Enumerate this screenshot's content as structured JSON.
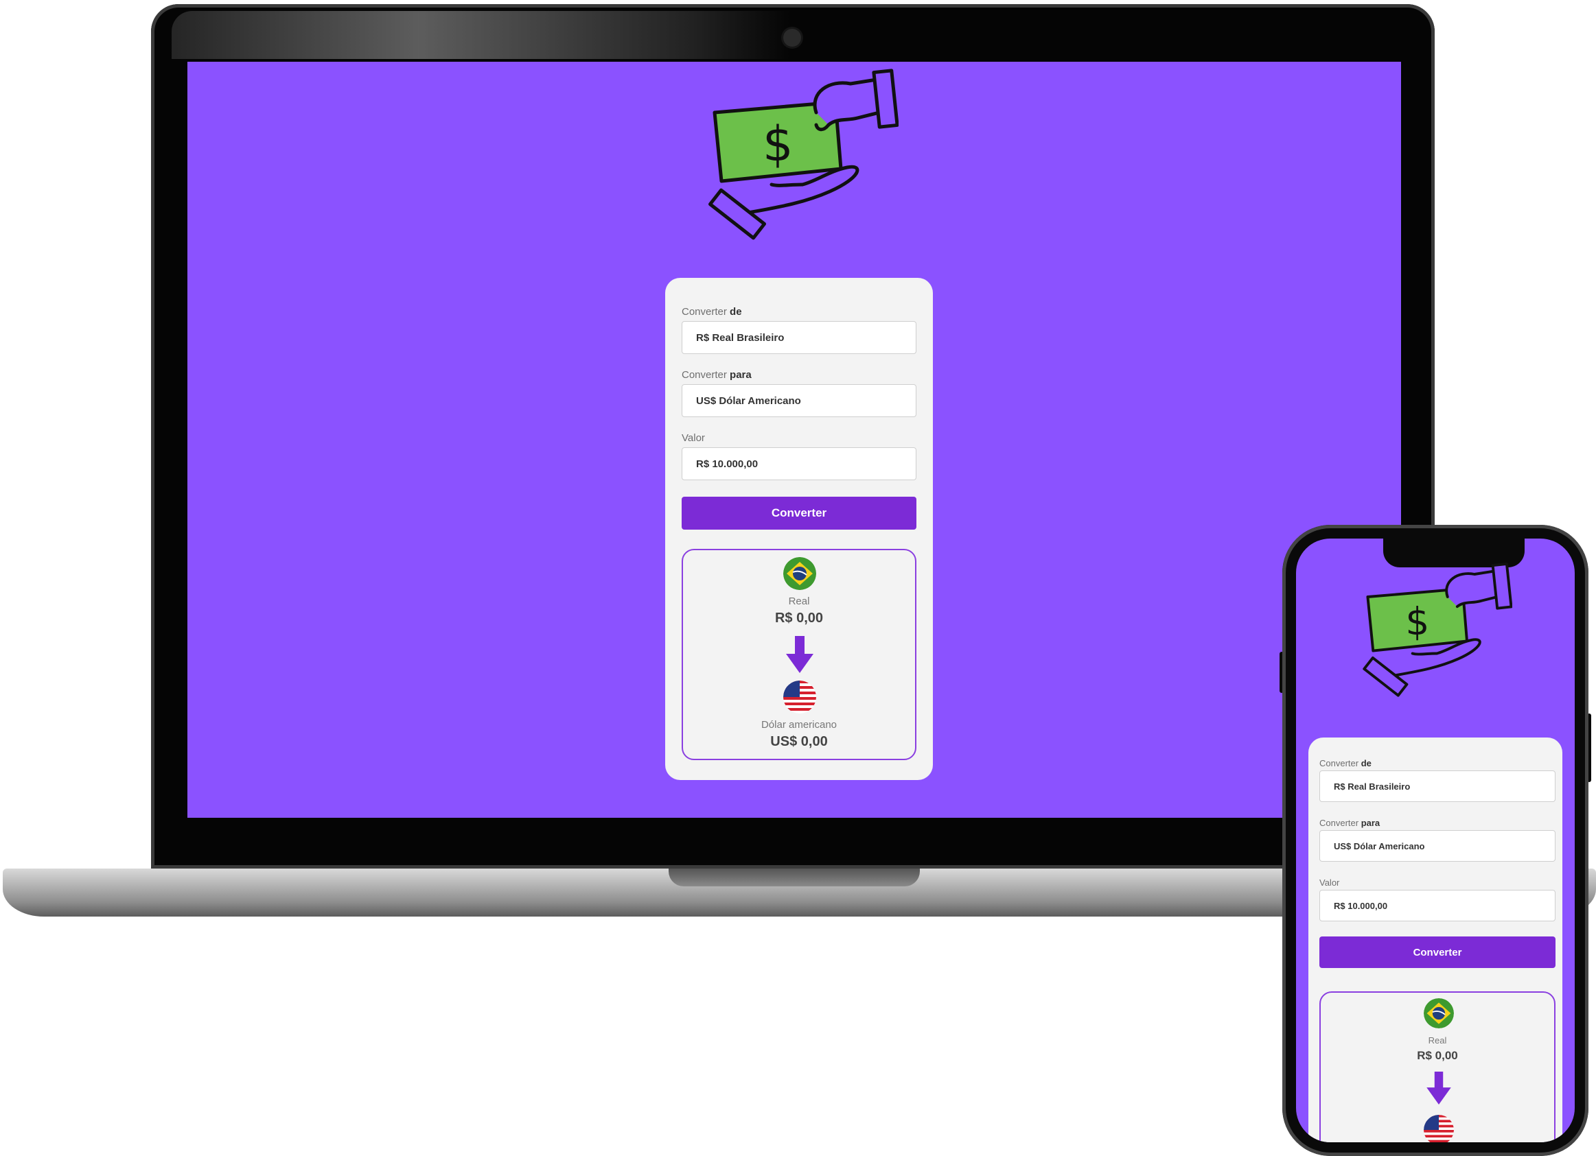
{
  "colors": {
    "screen_bg": "#8b52ff",
    "accent": "#7c2bd6",
    "card_bg": "#f3f3f3",
    "money_green": "#6cc04a"
  },
  "icons": {
    "hero": "money-exchange-hands-icon",
    "arrow": "arrow-down-icon",
    "from_flag": "brazil-flag-icon",
    "to_flag": "usa-flag-icon"
  },
  "converter": {
    "from_label_prefix": "Converter",
    "from_label_bold": "de",
    "from_value": "R$ Real Brasileiro",
    "to_label_prefix": "Converter",
    "to_label_bold": "para",
    "to_value": "US$ Dólar Americano",
    "amount_label": "Valor",
    "amount_placeholder": "R$ 10.000,00",
    "button_label": "Converter"
  },
  "result": {
    "from_currency_name": "Real",
    "from_amount": "R$ 0,00",
    "to_currency_name": "Dólar americano",
    "to_amount": "US$ 0,00"
  },
  "money_symbol": "$"
}
